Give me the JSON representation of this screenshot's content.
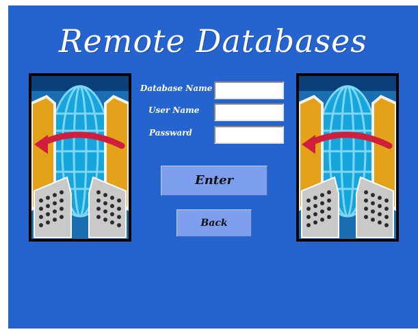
{
  "title": "Remote Databases",
  "form": {
    "database_name_label": "Database Name",
    "database_name_value": "",
    "user_name_label": "User Name",
    "user_name_value": "",
    "password_label": "Passward",
    "password_value": ""
  },
  "buttons": {
    "enter_label": "Enter",
    "back_label": "Back"
  },
  "decor": {
    "left_image": "network-globe-icon",
    "right_image": "network-globe-icon"
  },
  "colors": {
    "background": "#2563cf",
    "button": "#7e9eee",
    "text": "#ffffff"
  }
}
